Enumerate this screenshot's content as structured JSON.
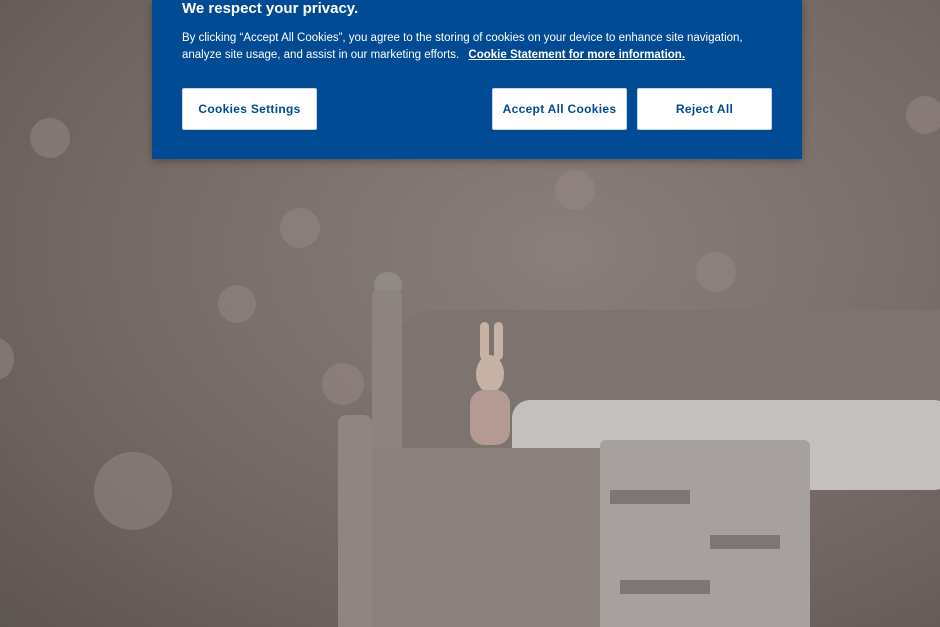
{
  "cookie_banner": {
    "title": "We respect your privacy.",
    "text": "By clicking “Accept All Cookies”, you agree to the storing of cookies on your device to enhance site navigation, analyze site usage, and assist in our marketing efforts.",
    "link_label": "Cookie Statement for more information.",
    "settings_label": "Cookies Settings",
    "accept_label": "Accept All Cookies",
    "reject_label": "Reject All",
    "background_color": "#004b93"
  }
}
